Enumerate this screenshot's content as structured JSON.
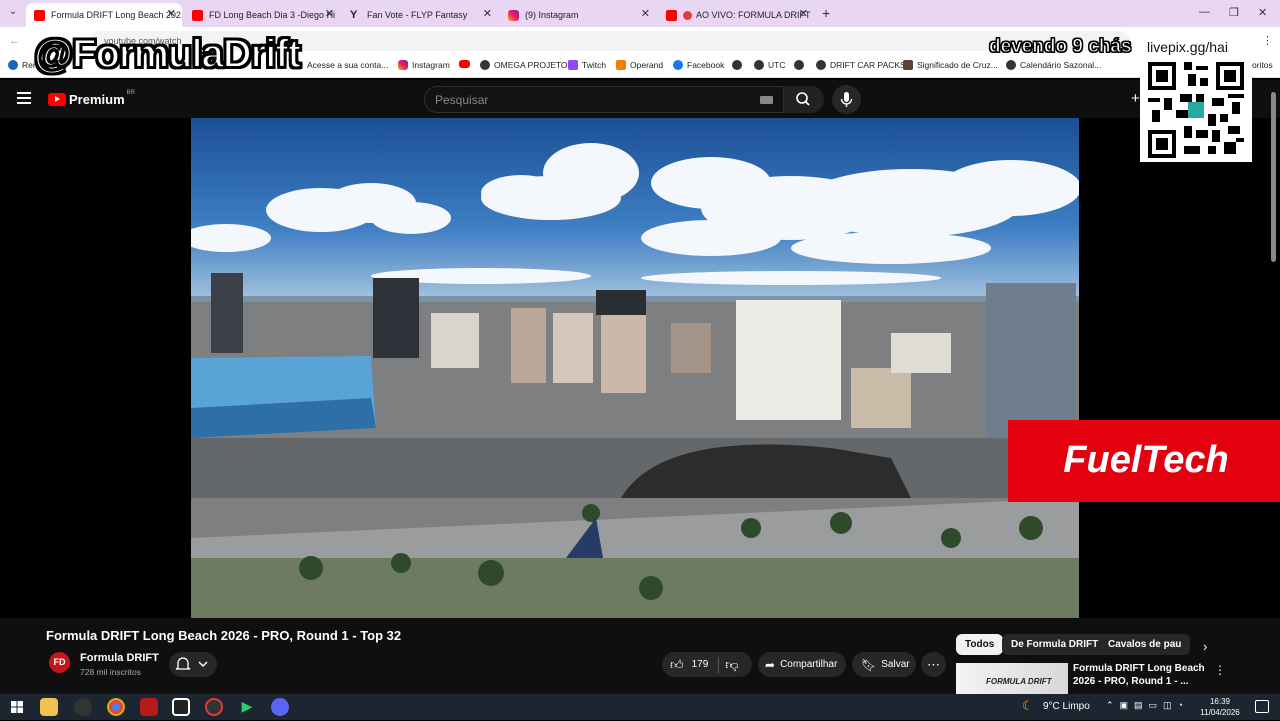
{
  "browser": {
    "tabs": [
      {
        "label": "Formula DRIFT Long Beach 202",
        "icon": "youtube-icon",
        "active": true
      },
      {
        "label": "FD Long Beach Dia 3 -Diego Hi",
        "icon": "youtube-icon",
        "active": false
      },
      {
        "label": "Fan Vote - FLYP Fantasy",
        "icon": "y-icon",
        "active": false
      },
      {
        "label": "(9) Instagram",
        "icon": "instagram-icon",
        "active": false
      },
      {
        "label": "AO VIVO: FORMULA DRIFT",
        "icon": "youtube-icon",
        "active": false
      }
    ],
    "address": "youtube.com/watch",
    "bookmarks": [
      "Acesse a sua conta...",
      "Instagram",
      "OMEGA PROJETO",
      "Twitch",
      "Operand",
      "Facebook",
      "UTC",
      "DRIFT CAR PACKS",
      "Significado de Cruz...",
      "Calendário Sazonal..."
    ],
    "bookmarks_left": "Rem",
    "bookmarks_right": "oritos"
  },
  "overlay": {
    "handle": "@FormulaDrift",
    "owing": "devendo 9 chás",
    "livepix": "livepix.gg/hai",
    "sponsor": "FuelTech"
  },
  "youtube": {
    "logo_text": "Premium",
    "region": "BR",
    "search_placeholder": "Pesquisar",
    "video_title": "Formula DRIFT Long Beach 2026 - PRO, Round 1 - Top 32",
    "channel_name": "Formula DRIFT",
    "channel_avatar": "FD",
    "subscribers": "728 mil inscritos",
    "likes": "179",
    "share_label": "Compartilhar",
    "save_label": "Salvar",
    "chips": [
      "Todos",
      "De Formula DRIFT",
      "Cavalos de pau"
    ],
    "rec_title": "Formula DRIFT Long Beach 2026 - PRO, Round 1 - ...",
    "rec_thumb_text": "FORMULA DRIFT"
  },
  "taskbar": {
    "weather": "9°C  Limpo",
    "time": "16:39",
    "date": "11/04/2026"
  }
}
